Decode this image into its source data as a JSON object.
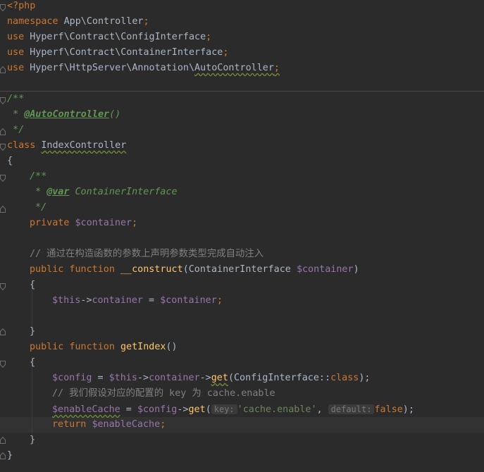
{
  "editor": {
    "lines": {
      "l1": "<?php",
      "l2_kw": "namespace",
      "l2_ns": " App\\Controller",
      "l2_semi": ";",
      "l3_kw": "use",
      "l3_ns": " Hyperf\\Contract\\ConfigInterface",
      "l3_semi": ";",
      "l4_kw": "use",
      "l4_ns": " Hyperf\\Contract\\ContainerInterface",
      "l4_semi": ";",
      "l5_kw": "use",
      "l5_ns_a": " Hyperf\\HttpServer\\Annotation\\",
      "l5_ns_b": "AutoController",
      "l5_semi": ";",
      "l7": "/**",
      "l8_pre": " * ",
      "l8_tag": "@AutoController",
      "l8_post": "()",
      "l9": " */",
      "l10_kw": "class",
      "l10_name": "IndexController",
      "l11": "{",
      "l12": "/**",
      "l13_pre": " * ",
      "l13_tag": "@var",
      "l13_post": " ContainerInterface",
      "l14": " */",
      "l15_kw": "private",
      "l15_var": "$container",
      "l15_semi": ";",
      "l17": "// 通过在构造函数的参数上声明参数类型完成自动注入",
      "l18_kw": "public function",
      "l18_fn": "__construct",
      "l18_a": "(ContainerInterface ",
      "l18_var": "$container",
      "l18_b": ")",
      "l19": "{",
      "l20_v1": "$this",
      "l20_a": "->",
      "l20_v2": "container",
      "l20_b": " = ",
      "l20_v3": "$container",
      "l20_semi": ";",
      "l22": "}",
      "l23_kw": "public function",
      "l23_fn": "getIndex",
      "l23_a": "()",
      "l24": "{",
      "l25_v1": "$config",
      "l25_a": " = ",
      "l25_v2": "$this",
      "l25_b": "->",
      "l25_v3": "container",
      "l25_c": "->",
      "l25_fn": "get",
      "l25_d": "(ConfigInterface::",
      "l25_kw": "class",
      "l25_e": ");",
      "l26": "// 我们假设对应的配置的 key 为 cache.enable",
      "l27_v1": "$enableCache",
      "l27_a": " = ",
      "l27_v2": "$config",
      "l27_b": "->",
      "l27_fn": "get",
      "l27_c": "(",
      "l27_h1": "key:",
      "l27_str": "'cache.enable'",
      "l27_d": ", ",
      "l27_h2": "default:",
      "l27_kw": "false",
      "l27_e": ");",
      "l28_kw": "return",
      "l28_var": "$enableCache",
      "l28_semi": ";",
      "l29": "}",
      "l30": "}"
    }
  }
}
